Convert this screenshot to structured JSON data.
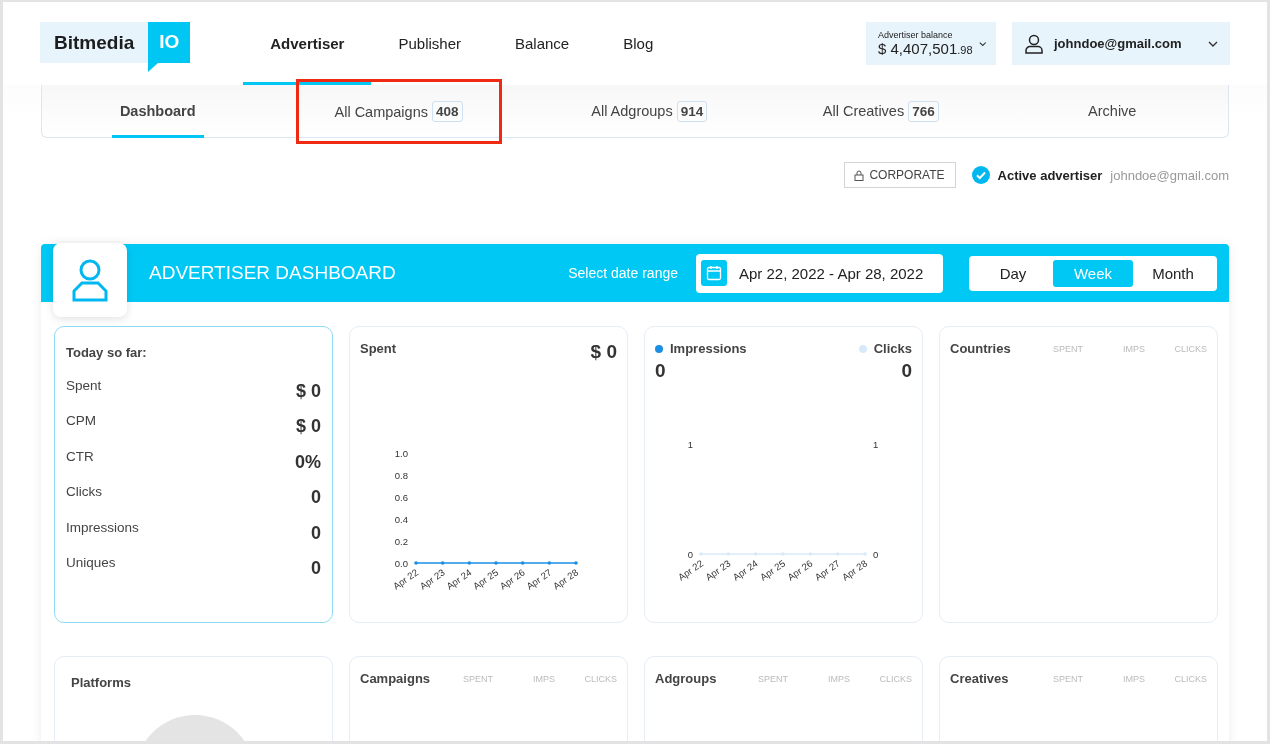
{
  "header": {
    "logo": {
      "word": "Bitmedia",
      "badge": "IO"
    },
    "nav": [
      {
        "label": "Advertiser",
        "selected": true
      },
      {
        "label": "Publisher",
        "selected": false
      },
      {
        "label": "Balance",
        "selected": false
      },
      {
        "label": "Blog",
        "selected": false
      }
    ],
    "balance": {
      "label": "Advertiser balance",
      "amount": "$ 4,407,501",
      "cents": ".98"
    },
    "user": {
      "email": "johndoe@gmail.com"
    }
  },
  "subnav": [
    {
      "label": "Dashboard",
      "selected": true,
      "highlighted": false
    },
    {
      "label": "All Campaigns",
      "count": "408",
      "selected": false,
      "highlighted": true
    },
    {
      "label": "All Adgroups",
      "count": "914",
      "selected": false,
      "highlighted": false
    },
    {
      "label": "All Creatives",
      "count": "766",
      "selected": false,
      "highlighted": false
    },
    {
      "label": "Archive",
      "selected": false,
      "highlighted": false
    }
  ],
  "account": {
    "type_button": "CORPORATE",
    "status": "Active advertiser",
    "email": "johndoe@gmail.com"
  },
  "dashboard": {
    "title": "ADVERTISER DASHBOARD",
    "date_label": "Select date range",
    "date_range": "Apr 22, 2022 - Apr 28, 2022",
    "periods": [
      {
        "label": "Day",
        "selected": false
      },
      {
        "label": "Week",
        "selected": true
      },
      {
        "label": "Month",
        "selected": false
      }
    ]
  },
  "cards": [
    {
      "kind": "summary",
      "title": "Today so far:",
      "metrics": [
        {
          "label": "Spent",
          "value": "$ 0"
        },
        {
          "label": "CPM",
          "value": "$ 0"
        },
        {
          "label": "CTR",
          "value": "0%"
        },
        {
          "label": "Clicks",
          "value": "0"
        },
        {
          "label": "Impressions",
          "value": "0"
        },
        {
          "label": "Uniques",
          "value": "0"
        }
      ]
    },
    {
      "kind": "chart",
      "title": "Spent",
      "value": "$ 0",
      "chart_data": {
        "type": "line",
        "categories": [
          "Apr 22",
          "Apr 23",
          "Apr 24",
          "Apr 25",
          "Apr 26",
          "Apr 27",
          "Apr 28"
        ],
        "series": [
          {
            "color": "#1a8fe3",
            "values": [
              0,
              0,
              0,
              0,
              0,
              0,
              0
            ]
          }
        ],
        "ylim": [
          0,
          1
        ],
        "yticks": [
          {
            "value": 0,
            "label": "0.0"
          },
          {
            "value": 0.2,
            "label": "0.2"
          },
          {
            "value": 0.4,
            "label": "0.4"
          },
          {
            "value": 0.6,
            "label": "0.6"
          },
          {
            "value": 0.8,
            "label": "0.8"
          },
          {
            "value": 1,
            "label": "1.0"
          }
        ]
      }
    },
    {
      "kind": "dual",
      "values": [
        "0",
        "0"
      ],
      "chart_data": {
        "type": "line",
        "categories": [
          "Apr 22",
          "Apr 23",
          "Apr 24",
          "Apr 25",
          "Apr 26",
          "Apr 27",
          "Apr 28"
        ],
        "series": [
          {
            "name": "Impressions",
            "color": "#1a8fe3",
            "values": [
              null,
              null,
              null,
              null,
              null,
              null,
              null
            ]
          },
          {
            "name": "Clicks",
            "color": "#d8eaf9",
            "values": [
              0,
              0,
              0,
              0,
              0,
              0,
              0
            ]
          }
        ],
        "ylim": [
          0,
          1
        ],
        "yticks": [
          0,
          1
        ],
        "y2ticks": [
          0,
          1
        ],
        "y2lim": [
          0,
          1
        ]
      }
    },
    {
      "kind": "table",
      "title": "Countries",
      "columns": [
        "SPENT",
        "IMPS",
        "CLICKS"
      ]
    },
    {
      "kind": "pie",
      "title": "Platforms"
    },
    {
      "kind": "table",
      "title": "Campaigns",
      "columns": [
        "SPENT",
        "IMPS",
        "CLICKS"
      ]
    },
    {
      "kind": "table",
      "title": "Adgroups",
      "columns": [
        "SPENT",
        "IMPS",
        "CLICKS"
      ]
    },
    {
      "kind": "table",
      "title": "Creatives",
      "columns": [
        "SPENT",
        "IMPS",
        "CLICKS"
      ]
    }
  ]
}
